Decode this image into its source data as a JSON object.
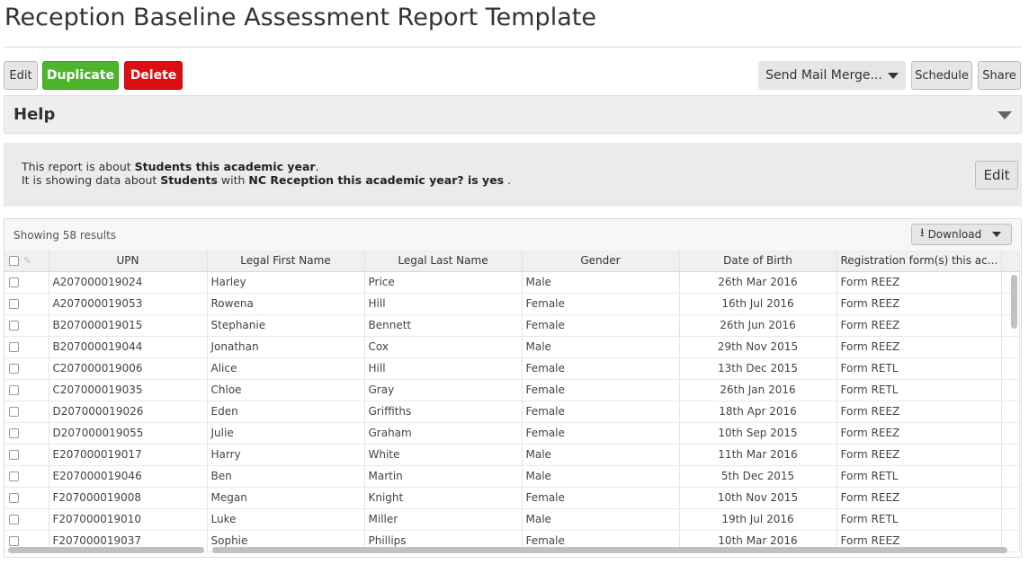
{
  "page": {
    "title": "Reception Baseline Assessment Report Template"
  },
  "toolbar": {
    "edit_label": "Edit",
    "duplicate_label": "Duplicate",
    "delete_label": "Delete",
    "mail_merge_label": "Send Mail Merge...",
    "schedule_label": "Schedule",
    "share_label": "Share"
  },
  "help": {
    "title": "Help"
  },
  "about": {
    "line1_prefix": "This report is about ",
    "line1_bold": "Students this academic year",
    "line1_suffix": ".",
    "line2_prefix": "It is showing data about ",
    "line2_bold1": "Students",
    "line2_mid": " with ",
    "line2_bold2": "NC Reception this academic year? is yes",
    "line2_suffix": " .",
    "edit_label": "Edit"
  },
  "grid": {
    "showing": "Showing 58 results",
    "download_label": "Download",
    "columns": [
      "UPN",
      "Legal First Name",
      "Legal Last Name",
      "Gender",
      "Date of Birth",
      "Registration form(s) this ac..."
    ],
    "rows": [
      [
        "A207000019024",
        "Harley",
        "Price",
        "Male",
        "26th Mar 2016",
        "Form REEZ"
      ],
      [
        "A207000019053",
        "Rowena",
        "Hill",
        "Female",
        "16th Jul 2016",
        "Form REEZ"
      ],
      [
        "B207000019015",
        "Stephanie",
        "Bennett",
        "Female",
        "26th Jun 2016",
        "Form REEZ"
      ],
      [
        "B207000019044",
        "Jonathan",
        "Cox",
        "Male",
        "29th Nov 2015",
        "Form REEZ"
      ],
      [
        "C207000019006",
        "Alice",
        "Hill",
        "Female",
        "13th Dec 2015",
        "Form RETL"
      ],
      [
        "C207000019035",
        "Chloe",
        "Gray",
        "Female",
        "26th Jan 2016",
        "Form RETL"
      ],
      [
        "D207000019026",
        "Eden",
        "Griffiths",
        "Female",
        "18th Apr 2016",
        "Form REEZ"
      ],
      [
        "D207000019055",
        "Julie",
        "Graham",
        "Female",
        "10th Sep 2015",
        "Form REEZ"
      ],
      [
        "E207000019017",
        "Harry",
        "White",
        "Male",
        "11th Mar 2016",
        "Form REEZ"
      ],
      [
        "E207000019046",
        "Ben",
        "Martin",
        "Male",
        "5th Dec 2015",
        "Form RETL"
      ],
      [
        "F207000019008",
        "Megan",
        "Knight",
        "Female",
        "10th Nov 2015",
        "Form REEZ"
      ],
      [
        "F207000019010",
        "Luke",
        "Miller",
        "Male",
        "19th Jul 2016",
        "Form RETL"
      ],
      [
        "F207000019037",
        "Sophie",
        "Phillips",
        "Female",
        "10th Mar 2016",
        "Form REEZ"
      ]
    ]
  },
  "colors": {
    "duplicate": "#4cb52b",
    "delete": "#dd0e13"
  }
}
